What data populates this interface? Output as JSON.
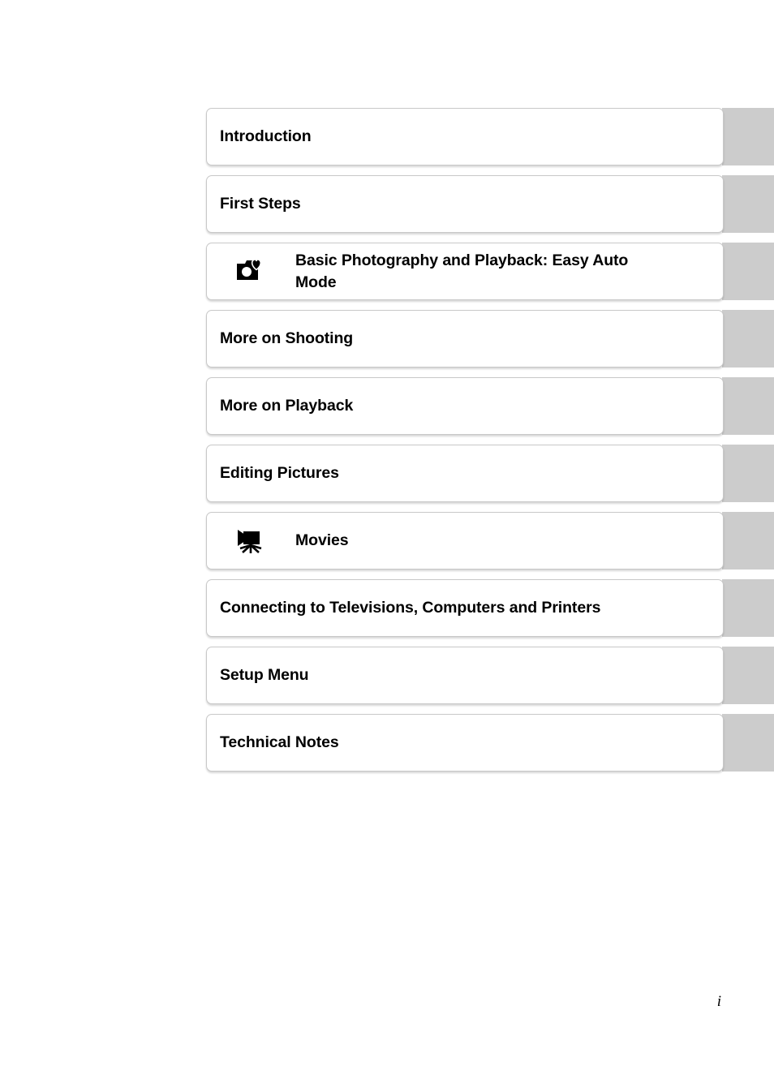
{
  "document": {
    "page_number": "i",
    "chapters": [
      {
        "title": "Introduction",
        "icon": null
      },
      {
        "title": "First Steps",
        "icon": null
      },
      {
        "title": "Basic Photography and Playback: Easy Auto\nMode",
        "icon": "camera-heart-icon"
      },
      {
        "title": "More on Shooting",
        "icon": null
      },
      {
        "title": "More on Playback",
        "icon": null
      },
      {
        "title": "Editing Pictures",
        "icon": null
      },
      {
        "title": "Movies",
        "icon": "movie-camera-icon"
      },
      {
        "title": "Connecting to Televisions, Computers and Printers",
        "icon": null
      },
      {
        "title": "Setup Menu",
        "icon": null
      },
      {
        "title": "Technical Notes",
        "icon": null
      }
    ]
  },
  "colors": {
    "tab_grey": "#cccccc",
    "card_border": "#c8c8c8",
    "card_background": "#ffffff",
    "text": "#000000",
    "page_background": "#ffffff"
  }
}
